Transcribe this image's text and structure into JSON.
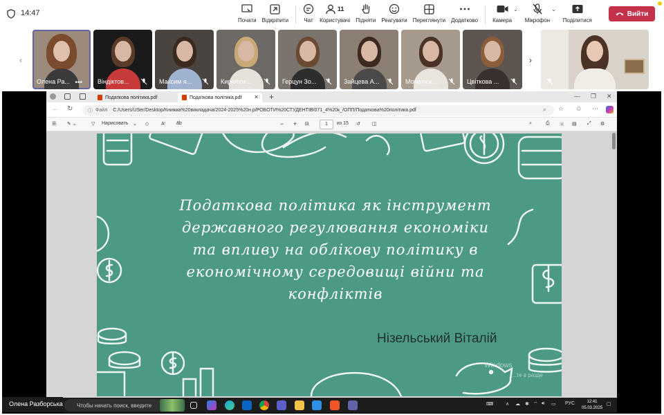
{
  "status": {
    "time": "14:47"
  },
  "toolbar": {
    "items": [
      {
        "label": "Почати"
      },
      {
        "label": "Відкріпити"
      },
      {
        "label": "Чат"
      },
      {
        "label": "Користувачі",
        "badge": "11"
      },
      {
        "label": "Підняти"
      },
      {
        "label": "Реагувати"
      },
      {
        "label": "Переглянути"
      },
      {
        "label": "Додатково"
      },
      {
        "label": "Камера"
      },
      {
        "label": "Мікрофон"
      },
      {
        "label": "Поділитися"
      }
    ],
    "leave_label": "Вийти",
    "leave_color": "#c4314b"
  },
  "participants": [
    {
      "name": "Олена Ра..."
    },
    {
      "name": "Віндіктов..."
    },
    {
      "name": "Максим  я..."
    },
    {
      "name": "Кирилюк ..."
    },
    {
      "name": "Герцун Зо..."
    },
    {
      "name": "Зайцева А..."
    },
    {
      "name": "Момотюк ..."
    },
    {
      "name": "Цвіткова ..."
    }
  ],
  "browser": {
    "tabs": [
      {
        "title": "Податкова політика.pdf"
      },
      {
        "title": "Податкова політика.pdf"
      }
    ],
    "url_prefix": "Файл",
    "url": "C:/Users/USer/Desktop/Книжка%20викладача/2024-2025%20н.р/РОБОТИ%20СТУДЕНТІВ/071_4%20к_/ОПП/Податкова%20політика.pdf"
  },
  "pdf_toolbar": {
    "draw_label": "Нарисовать",
    "page_current": "1",
    "page_total": "из 15"
  },
  "slide": {
    "title": "Податкова політика як інструмент державного регулювання економіки та впливу на облікову політику в економічному середовищі війни та конфліктів",
    "author": "Нізельський Віталій",
    "bg_color": "#4c9a85",
    "watermark": "Windows",
    "watermark_sub": "...те в разде"
  },
  "presenter": {
    "name": "Олена Разборська"
  },
  "taskbar": {
    "search_placeholder": "Чтобы начать поиск, введите",
    "lang": "РУС",
    "time": "12:41",
    "date": "05.03.2025"
  }
}
